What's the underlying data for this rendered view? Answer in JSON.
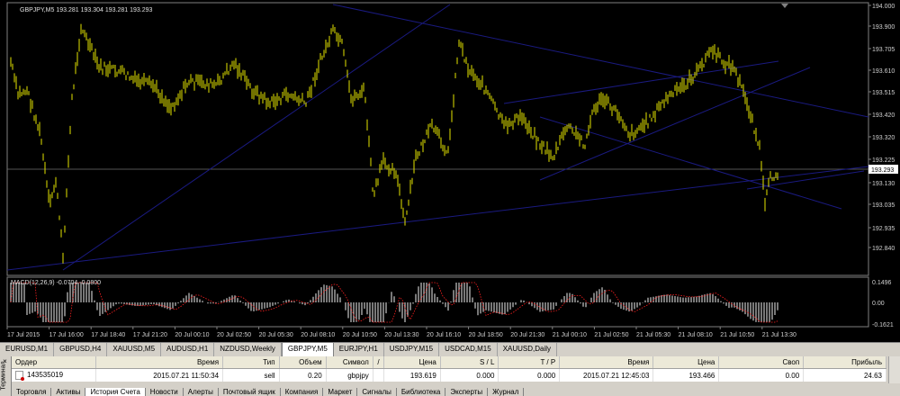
{
  "chart": {
    "header": "GBPJPY,M5  193.281 193.304 193.281 193.293",
    "indicator_label": "MACD(12,26,9) -0.0704 -0.0800",
    "current_price": "193.293",
    "price_labels": [
      "194.000",
      "193.900",
      "193.705",
      "193.610",
      "193.515",
      "193.420",
      "193.320",
      "193.225",
      "193.130",
      "193.035",
      "192.935",
      "192.840"
    ],
    "macd_labels": [
      "0.1496",
      "0.00",
      "-0.1621"
    ],
    "time_labels": [
      "17 Jul 2015",
      "17 Jul 16:00",
      "17 Jul 18:40",
      "17 Jul 21:20",
      "20 Jul 00:10",
      "20 Jul 02:50",
      "20 Jul 05:30",
      "20 Jul 08:10",
      "20 Jul 10:50",
      "20 Jul 13:30",
      "20 Jul 16:10",
      "20 Jul 18:50",
      "20 Jul 21:30",
      "21 Jul 00:10",
      "21 Jul 02:50",
      "21 Jul 05:30",
      "21 Jul 08:10",
      "21 Jul 10:50",
      "21 Jul 13:30"
    ],
    "colors": {
      "bars": "#e5e500",
      "trendline": "#1a1a80",
      "signal": "#ff2020",
      "hist": "#c8c8c8",
      "price_line": "#707070"
    }
  },
  "symbol_tabs": [
    "EURUSD,M1",
    "GBPUSD,H4",
    "XAUUSD,M5",
    "AUDUSD,H1",
    "NZDUSD,Weekly",
    "GBPJPY,M5",
    "EURJPY,H1",
    "USDJPY,M15",
    "USDCAD,M15",
    "XAUUSD,Daily"
  ],
  "active_tab": "GBPJPY,M5",
  "terminal": {
    "side_label": "Терминал",
    "close": "×",
    "columns": [
      "Ордер",
      "Время",
      "Тип",
      "Объем",
      "Символ",
      "/",
      "Цена",
      "S / L",
      "T / P",
      "Время",
      "Цена",
      "Своп",
      "Прибыль"
    ],
    "row": {
      "order": "143535019",
      "open_time": "2015.07.21 11:50:34",
      "type": "sell",
      "volume": "0.20",
      "symbol": "gbpjpy",
      "price": "193.619",
      "sl": "0.000",
      "tp": "0.000",
      "close_time": "2015.07.21 12:45:03",
      "close_price": "193.466",
      "swap": "0.00",
      "profit": "24.63"
    },
    "bottom_tabs": [
      "Торговля",
      "Активы",
      "История Счета",
      "Новости",
      "Алерты",
      "Почтовый ящик",
      "Компания",
      "Маркет",
      "Сигналы",
      "Библиотека",
      "Эксперты",
      "Журнал"
    ],
    "active_bottom_tab": "История Счета"
  }
}
